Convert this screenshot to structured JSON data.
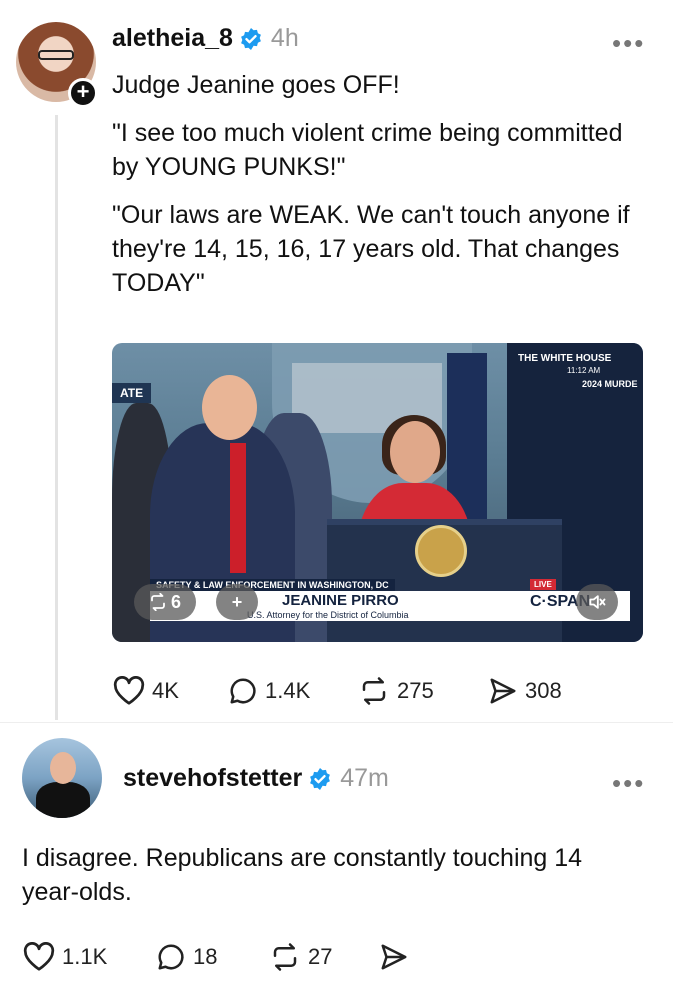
{
  "post1": {
    "username": "aletheia_8",
    "time": "4h",
    "more": "•••",
    "follow_icon": "plus-icon",
    "paragraphs": [
      "Judge Jeanine goes OFF!",
      "\"I see too much violent crime being committed by YOUNG PUNKS!\"",
      "\"Our laws are WEAK. We can't touch anyone if they're 14, 15, 16, 17 years old. That changes TODAY\""
    ],
    "video": {
      "network_label": "THE WHITE HOUSE",
      "clock": "11:12 AM",
      "banner_right": "2024 MURDE",
      "banner_left": "ATE",
      "lower_third_top": "SAFETY & LAW ENFORCEMENT IN WASHINGTON, DC",
      "lower_third_name": "JEANINE PIRRO",
      "lower_third_sub": "U.S. Attorney for the District of Columbia",
      "channel": "C·SPAN",
      "live": "LIVE",
      "repost_count": "6",
      "plus_label": "+"
    },
    "actions": {
      "likes": "4K",
      "replies": "1.4K",
      "reposts": "275",
      "shares": "308"
    }
  },
  "post2": {
    "username": "stevehofstetter",
    "time": "47m",
    "more": "•••",
    "text": "I disagree. Republicans are constantly touching 14 year-olds.",
    "actions": {
      "likes": "1.1K",
      "replies": "18",
      "reposts": "27"
    }
  },
  "colors": {
    "verified_blue": "#1d9bf0",
    "muted_gray": "#999999",
    "text": "#111111"
  }
}
